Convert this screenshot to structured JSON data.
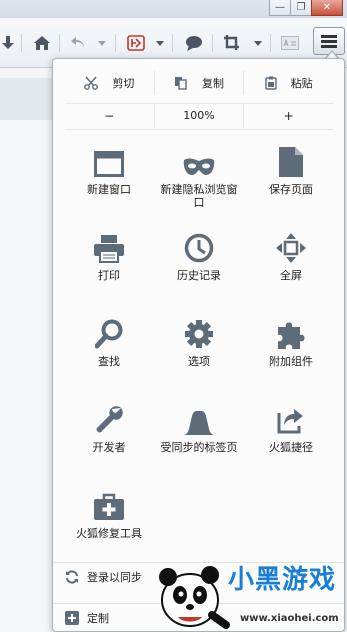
{
  "window": {
    "minimize": "—",
    "restore": "❐",
    "close": "✕"
  },
  "panel": {
    "edit": {
      "cut": "剪切",
      "copy": "复制",
      "paste": "粘贴"
    },
    "zoom": {
      "out": "−",
      "level": "100%",
      "in": "+"
    },
    "items": [
      {
        "label": "新建窗口",
        "icon": "new-window-icon"
      },
      {
        "label": "新建隐私浏览窗口",
        "icon": "private-mask-icon"
      },
      {
        "label": "保存页面",
        "icon": "save-page-icon"
      },
      {
        "label": "打印",
        "icon": "print-icon"
      },
      {
        "label": "历史记录",
        "icon": "history-clock-icon"
      },
      {
        "label": "全屏",
        "icon": "fullscreen-icon"
      },
      {
        "label": "查找",
        "icon": "search-icon"
      },
      {
        "label": "选项",
        "icon": "gear-icon"
      },
      {
        "label": "附加组件",
        "icon": "puzzle-icon"
      },
      {
        "label": "开发者",
        "icon": "wrench-icon"
      },
      {
        "label": "受同步的标签页",
        "icon": "synced-tabs-icon"
      },
      {
        "label": "火狐捷径",
        "icon": "share-shortcut-icon"
      },
      {
        "label": "火狐修复工具",
        "icon": "first-aid-kit-icon"
      }
    ],
    "sync_label": "登录以同步",
    "customize_label": "定制"
  },
  "watermark": {
    "brand": "小黑游戏",
    "url": "www.xiaohei.com"
  },
  "colors": {
    "icon": "#5e6b78",
    "accent_red": "#c0392b",
    "watermark_blue": "#1a7fd4"
  }
}
